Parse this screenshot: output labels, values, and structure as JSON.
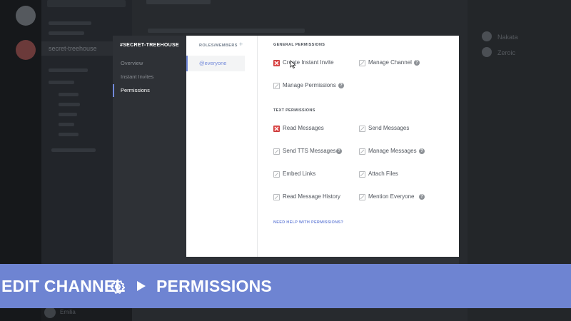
{
  "background": {
    "active_channel": "secret-treehouse",
    "members": [
      "Nakata",
      "Zeroic"
    ],
    "user": "Emilia"
  },
  "modal": {
    "channel_title": "#SECRET-TREEHOUSE",
    "nav": [
      {
        "label": "Overview"
      },
      {
        "label": "Instant Invites"
      },
      {
        "label": "Permissions",
        "active": true
      }
    ],
    "roles_header": "ROLES/MEMBERS",
    "roles_add": "+",
    "roles": [
      {
        "label": "@everyone",
        "selected": true
      }
    ],
    "sections": [
      {
        "title": "GENERAL PERMISSIONS",
        "permissions": [
          {
            "label": "Create Instant Invite",
            "state": "denied",
            "help": false
          },
          {
            "label": "Manage Channel",
            "state": "neutral",
            "help": true
          },
          {
            "label": "Manage Permissions",
            "state": "neutral",
            "help": true
          }
        ]
      },
      {
        "title": "TEXT PERMISSIONS",
        "permissions": [
          {
            "label": "Read Messages",
            "state": "denied",
            "help": false
          },
          {
            "label": "Send Messages",
            "state": "neutral",
            "help": false
          },
          {
            "label": "Send TTS Messages",
            "state": "neutral",
            "help": true
          },
          {
            "label": "Manage Messages",
            "state": "neutral",
            "help": true
          },
          {
            "label": "Embed Links",
            "state": "neutral",
            "help": false
          },
          {
            "label": "Attach Files",
            "state": "neutral",
            "help": false
          },
          {
            "label": "Read Message History",
            "state": "neutral",
            "help": false
          },
          {
            "label": "Mention Everyone",
            "state": "neutral",
            "help": true
          }
        ]
      }
    ],
    "help_link": "NEED HELP WITH PERMISSIONS?",
    "help_glyph": "?"
  },
  "banner": {
    "part1": "EDIT CHANNEL",
    "part2": "PERMISSIONS",
    "icons": [
      "gear-icon",
      "play-arrow-icon"
    ]
  },
  "colors": {
    "accent": "#7289da",
    "deny": "#e14545",
    "banner": "#6e84d2"
  }
}
